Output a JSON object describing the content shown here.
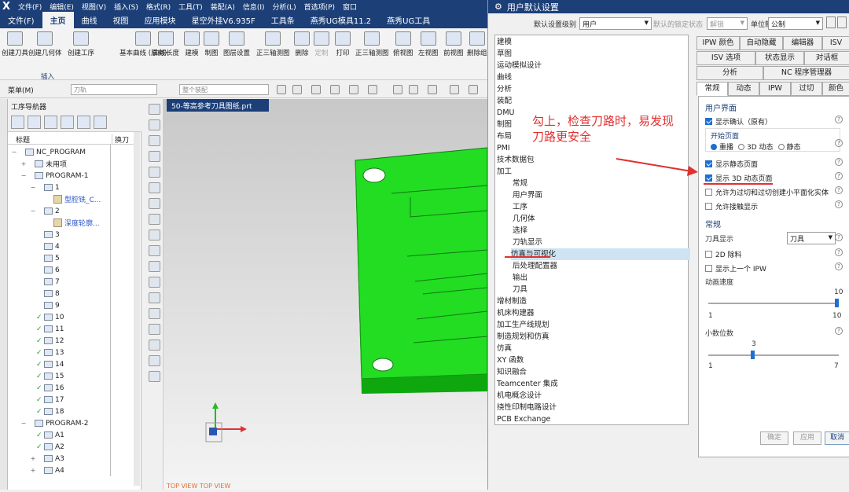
{
  "titlebar": {
    "menus": [
      "文件(F)",
      "编辑(E)",
      "视图(V)",
      "插入(S)",
      "格式(R)",
      "工具(T)",
      "装配(A)",
      "信息(I)",
      "分析(L)",
      "首选项(P)",
      "窗口"
    ]
  },
  "ribbon_tabs": [
    "文件(F)",
    "主页",
    "曲线",
    "视图",
    "应用模块",
    "星空外挂V6.935F",
    "工具条",
    "燕秀UG模具11.2",
    "燕秀UG工具"
  ],
  "ribbon_buttons": [
    "创建刀具",
    "创建几何体",
    "创建工序",
    "基本曲线 (原有)",
    "曲线长度",
    "建模",
    "制图",
    "图层设置",
    "正三轴测图",
    "删除",
    "定制",
    "打印",
    "正三轴测图",
    "俯视图",
    "左视图",
    "前视图",
    "删除组"
  ],
  "ribbon_group_label": "插入",
  "toolbar2": {
    "menu": "菜单(M)",
    "combo1": "刀轨",
    "combo2": "整个装配"
  },
  "nav": {
    "title": "工序导航器",
    "col_title": "标题",
    "col_tool": "换刀"
  },
  "tree": [
    {
      "indent": 0,
      "exp": "−",
      "text": "NC_PROGRAM",
      "check": false,
      "icon": "folder"
    },
    {
      "indent": 1,
      "exp": "+",
      "text": "未用项",
      "check": false,
      "icon": "folder"
    },
    {
      "indent": 1,
      "exp": "−",
      "text": "PROGRAM-1",
      "check": false,
      "icon": "folder"
    },
    {
      "indent": 2,
      "exp": "−",
      "text": "1",
      "check": false,
      "icon": "folder"
    },
    {
      "indent": 3,
      "exp": "",
      "text": "型腔铣_C...",
      "check": false,
      "icon": "op"
    },
    {
      "indent": 2,
      "exp": "−",
      "text": "2",
      "check": false,
      "icon": "folder"
    },
    {
      "indent": 3,
      "exp": "",
      "text": "深度轮廓...",
      "check": false,
      "icon": "op"
    },
    {
      "indent": 2,
      "exp": "",
      "text": "3",
      "check": false,
      "icon": "folder"
    },
    {
      "indent": 2,
      "exp": "",
      "text": "4",
      "check": false,
      "icon": "folder"
    },
    {
      "indent": 2,
      "exp": "",
      "text": "5",
      "check": false,
      "icon": "folder"
    },
    {
      "indent": 2,
      "exp": "",
      "text": "6",
      "check": false,
      "icon": "folder"
    },
    {
      "indent": 2,
      "exp": "",
      "text": "7",
      "check": false,
      "icon": "folder"
    },
    {
      "indent": 2,
      "exp": "",
      "text": "8",
      "check": false,
      "icon": "folder"
    },
    {
      "indent": 2,
      "exp": "",
      "text": "9",
      "check": false,
      "icon": "folder"
    },
    {
      "indent": 2,
      "exp": "",
      "text": "10",
      "check": true,
      "icon": "folder"
    },
    {
      "indent": 2,
      "exp": "",
      "text": "11",
      "check": true,
      "icon": "folder"
    },
    {
      "indent": 2,
      "exp": "",
      "text": "12",
      "check": true,
      "icon": "folder"
    },
    {
      "indent": 2,
      "exp": "",
      "text": "13",
      "check": true,
      "icon": "folder"
    },
    {
      "indent": 2,
      "exp": "",
      "text": "14",
      "check": true,
      "icon": "folder"
    },
    {
      "indent": 2,
      "exp": "",
      "text": "15",
      "check": true,
      "icon": "folder"
    },
    {
      "indent": 2,
      "exp": "",
      "text": "16",
      "check": true,
      "icon": "folder"
    },
    {
      "indent": 2,
      "exp": "",
      "text": "17",
      "check": true,
      "icon": "folder"
    },
    {
      "indent": 2,
      "exp": "",
      "text": "18",
      "check": true,
      "icon": "folder"
    },
    {
      "indent": 1,
      "exp": "−",
      "text": "PROGRAM-2",
      "check": false,
      "icon": "folder"
    },
    {
      "indent": 2,
      "exp": "",
      "text": "A1",
      "check": true,
      "icon": "folder"
    },
    {
      "indent": 2,
      "exp": "",
      "text": "A2",
      "check": true,
      "icon": "folder"
    },
    {
      "indent": 2,
      "exp": "+",
      "text": "A3",
      "check": false,
      "icon": "folder"
    },
    {
      "indent": 2,
      "exp": "+",
      "text": "A4",
      "check": false,
      "icon": "folder"
    }
  ],
  "file_tab": "50-等高参考刀具图纸.prt",
  "view_label": "TOP VIEW   TOP VIEW",
  "dialog": {
    "title": "用户默认设置",
    "level_label": "默认设置级别",
    "level_value": "用户",
    "locked_label": "默认的锁定状态",
    "locked_value": "解锁",
    "unit_label": "单位制",
    "unit_value": "公制",
    "categories": [
      {
        "t": "建模",
        "c": false
      },
      {
        "t": "草图",
        "c": false
      },
      {
        "t": "运动模拟设计",
        "c": false
      },
      {
        "t": "曲线",
        "c": false
      },
      {
        "t": "分析",
        "c": false
      },
      {
        "t": "装配",
        "c": false
      },
      {
        "t": "DMU",
        "c": false
      },
      {
        "t": "制图",
        "c": false
      },
      {
        "t": "布局",
        "c": false
      },
      {
        "t": "PMI",
        "c": false
      },
      {
        "t": "技术数据包",
        "c": false
      },
      {
        "t": "加工",
        "c": false
      },
      {
        "t": "常规",
        "c": true
      },
      {
        "t": "用户界面",
        "c": true
      },
      {
        "t": "工序",
        "c": true
      },
      {
        "t": "几何体",
        "c": true
      },
      {
        "t": "选择",
        "c": true
      },
      {
        "t": "刀轨显示",
        "c": true
      },
      {
        "t": "仿真与可视化",
        "c": true
      },
      {
        "t": "后处理配置器",
        "c": true
      },
      {
        "t": "输出",
        "c": true
      },
      {
        "t": "刀具",
        "c": true
      },
      {
        "t": "增材制造",
        "c": false
      },
      {
        "t": "机床构建器",
        "c": false
      },
      {
        "t": "加工生产线规划",
        "c": false
      },
      {
        "t": "制造规划和仿真",
        "c": false
      },
      {
        "t": "仿真",
        "c": false
      },
      {
        "t": "XY 函数",
        "c": false
      },
      {
        "t": "知识融合",
        "c": false
      },
      {
        "t": "Teamcenter 集成",
        "c": false
      },
      {
        "t": "机电概念设计",
        "c": false
      },
      {
        "t": "挠性印制电路设计",
        "c": false
      },
      {
        "t": "PCB Exchange",
        "c": false
      }
    ],
    "tabs_row1": [
      "IPW 颜色",
      "自动隐藏",
      "编辑器",
      "ISV"
    ],
    "tabs_row2": [
      "ISV 选项",
      "状态显示",
      "对话框"
    ],
    "tabs_row3": [
      "分析",
      "NC 程序管理器"
    ],
    "tabs_row4": [
      "常规",
      "动态",
      "IPW",
      "过切",
      "颜色"
    ],
    "ui_section": "用户界面",
    "show_confirm": "显示确认（原有）",
    "start_page": "开始页面",
    "radio_opts": [
      "重播",
      "3D 动态",
      "静态"
    ],
    "show_static": "显示静态页面",
    "show_3d": "显示 3D 动态页面",
    "allow_gouge": "允许为过切和过切创建小平面化实体",
    "allow_contact": "允许接触显示",
    "general_section": "常规",
    "tool_display_label": "刀具显示",
    "tool_display_value": "刀具",
    "opt_2d": "2D 除料",
    "opt_prev_ipw": "显示上一个 IPW",
    "anim_speed": "动画速度",
    "anim_value": "10",
    "anim_min": "1",
    "anim_max": "10",
    "decimals": "小数位数",
    "decimals_value": "3",
    "dec_min": "1",
    "dec_max": "7",
    "btn_ok": "确定",
    "btn_apply": "应用",
    "btn_cancel": "取消"
  },
  "annotation": "勾上，检查刀路时，易发现\n刀路更安全",
  "colors": {
    "accent": "#1c3f78",
    "part": "#22dd22",
    "note": "#e23030"
  }
}
